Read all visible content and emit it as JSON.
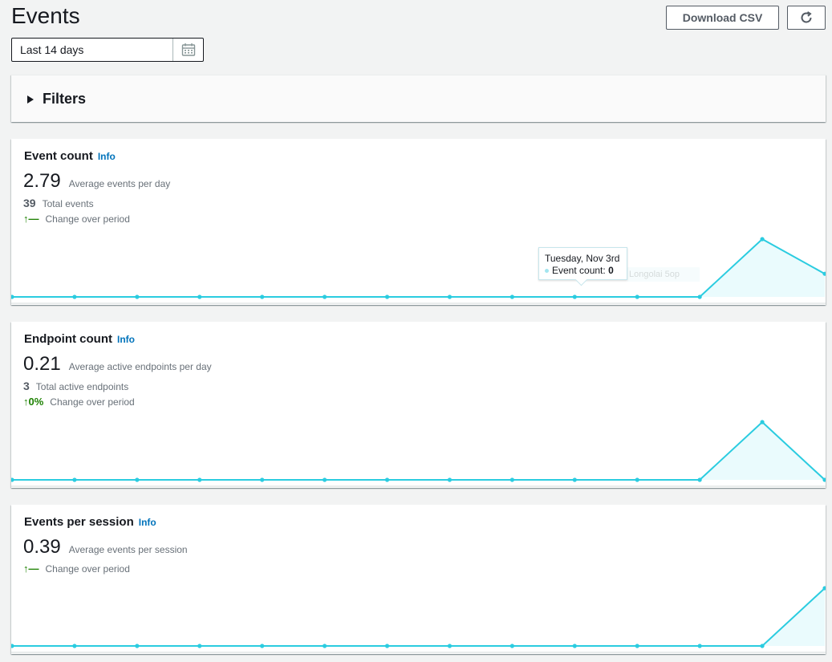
{
  "page": {
    "title": "Events"
  },
  "toolbar": {
    "download_label": "Download CSV",
    "refresh_icon": "refresh-icon"
  },
  "date_range": {
    "value": "Last 14 days",
    "icon": "calendar-icon"
  },
  "filters": {
    "label": "Filters",
    "expanded": false
  },
  "colors": {
    "accent": "#0073bb",
    "line": "#2bcce0",
    "fill": "#eafbfd",
    "positive": "#1d8102"
  },
  "cards": [
    {
      "title": "Event count",
      "info": "Info",
      "primary_value": "2.79",
      "primary_label": "Average events per day",
      "secondary_value": "39",
      "secondary_label": "Total events",
      "change_value": "↑—",
      "change_label": "Change over period",
      "tooltip": {
        "date": "Tuesday, Nov 3rd",
        "series": "Event count:",
        "value": "0",
        "ghost": "Longolai 5op"
      }
    },
    {
      "title": "Endpoint count",
      "info": "Info",
      "primary_value": "0.21",
      "primary_label": "Average active endpoints per day",
      "secondary_value": "3",
      "secondary_label": "Total active endpoints",
      "change_value": "↑0%",
      "change_label": "Change over period"
    },
    {
      "title": "Events per session",
      "info": "Info",
      "primary_value": "0.39",
      "primary_label": "Average events per session",
      "change_value": "↑—",
      "change_label": "Change over period"
    }
  ],
  "chart_data": [
    {
      "type": "area",
      "series": [
        {
          "name": "Event count",
          "values": [
            0,
            0,
            0,
            0,
            0,
            0,
            0,
            0,
            0,
            0,
            0,
            0,
            1,
            0.4
          ]
        }
      ]
    },
    {
      "type": "area",
      "series": [
        {
          "values": [
            0,
            0,
            0,
            0,
            0,
            0,
            0,
            0,
            0,
            0,
            0,
            0,
            1,
            0
          ]
        }
      ]
    },
    {
      "type": "area",
      "series": [
        {
          "values": [
            0,
            0,
            0,
            0,
            0,
            0,
            0,
            0,
            0,
            0,
            0,
            0,
            0,
            1
          ]
        }
      ]
    }
  ]
}
